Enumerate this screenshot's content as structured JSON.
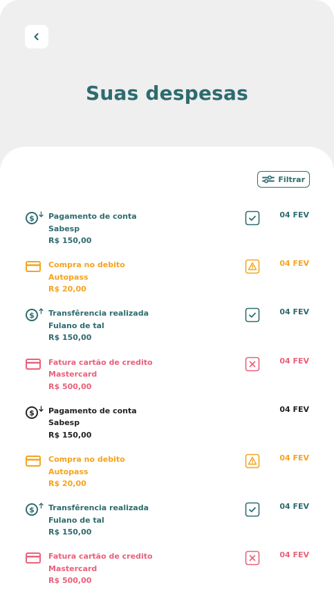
{
  "header": {
    "title": "Suas despesas"
  },
  "filter": {
    "label": "Filtrar"
  },
  "colors": {
    "teal": "#2e6b6e",
    "orange": "#f5a31c",
    "red": "#e9607a",
    "dark": "#222222",
    "background": "#efefef"
  },
  "items": [
    {
      "title": "Pagamento de conta",
      "subtitle": "Sabesp",
      "amount": "R$ 150,00",
      "date": "04 FEV",
      "icon": "coin-down-icon",
      "status": "check-icon",
      "color": "teal"
    },
    {
      "title": "Compra no debito",
      "subtitle": "Autopass",
      "amount": "R$ 20,00",
      "date": "04 FEV",
      "icon": "card-icon",
      "status": "warning-icon",
      "color": "orange"
    },
    {
      "title": "Transfêrencia realizada",
      "subtitle": "Fulano de tal",
      "amount": "R$ 150,00",
      "date": "04 FEV",
      "icon": "coin-up-icon",
      "status": "check-icon",
      "color": "teal"
    },
    {
      "title": "Fatura cartão de credito",
      "subtitle": "Mastercard",
      "amount": "R$ 500,00",
      "date": "04 FEV",
      "icon": "card-icon",
      "status": "close-icon",
      "color": "red"
    },
    {
      "title": "Pagamento de conta",
      "subtitle": "Sabesp",
      "amount": "R$ 150,00",
      "date": "04 FEV",
      "icon": "coin-down-icon",
      "status": "none",
      "color": "dark"
    },
    {
      "title": "Compra no debito",
      "subtitle": "Autopass",
      "amount": "R$ 20,00",
      "date": "04 FEV",
      "icon": "card-icon",
      "status": "warning-icon",
      "color": "orange"
    },
    {
      "title": "Transfêrencia realizada",
      "subtitle": "Fulano de tal",
      "amount": "R$ 150,00",
      "date": "04 FEV",
      "icon": "coin-up-icon",
      "status": "check-icon",
      "color": "teal"
    },
    {
      "title": "Fatura cartão de credito",
      "subtitle": "Mastercard",
      "amount": "R$ 500,00",
      "date": "04 FEV",
      "icon": "card-icon",
      "status": "close-icon",
      "color": "red"
    }
  ]
}
